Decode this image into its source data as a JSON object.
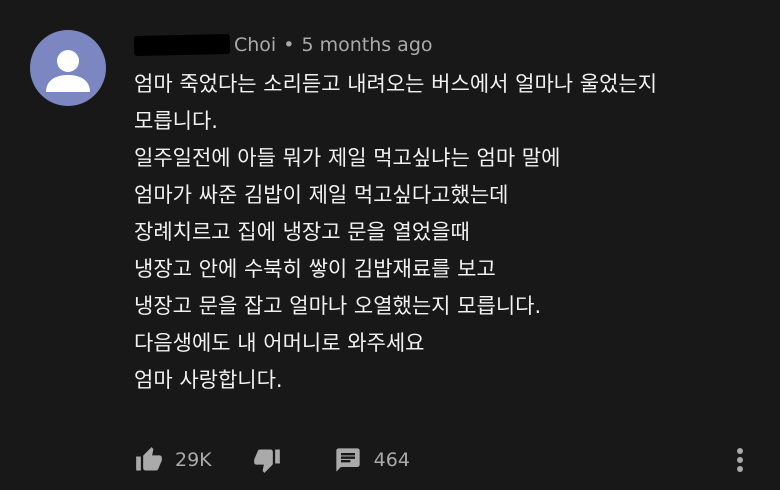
{
  "comment": {
    "author_suffix": "Choi",
    "separator": "•",
    "timestamp": "5 months ago",
    "lines": [
      "엄마 죽었다는 소리듣고 내려오는 버스에서 얼마나 울었는지",
      "모릅니다.",
      "일주일전에 아들 뭐가 제일 먹고싶냐는 엄마 말에",
      "엄마가 싸준 김밥이 제일 먹고싶다고했는데",
      "장례치르고 집에 냉장고 문을 열었을때",
      "냉장고 안에 수북히 쌓이 김밥재료를 보고",
      "냉장고 문을 잡고 얼마나 오열했는지 모릅니다.",
      "다음생에도 내 어머니로 와주세요",
      "엄마 사랑합니다."
    ],
    "likes": "29K",
    "replies": "464"
  },
  "icons": {
    "avatar": "default-avatar-icon",
    "like": "thumbs-up-icon",
    "dislike": "thumbs-down-icon",
    "reply": "comment-icon",
    "more": "more-vert-icon"
  },
  "colors": {
    "background": "#181818",
    "avatar_bg": "#7c87c2",
    "text_primary": "#f1f1f1",
    "text_secondary": "#aaaaaa"
  }
}
